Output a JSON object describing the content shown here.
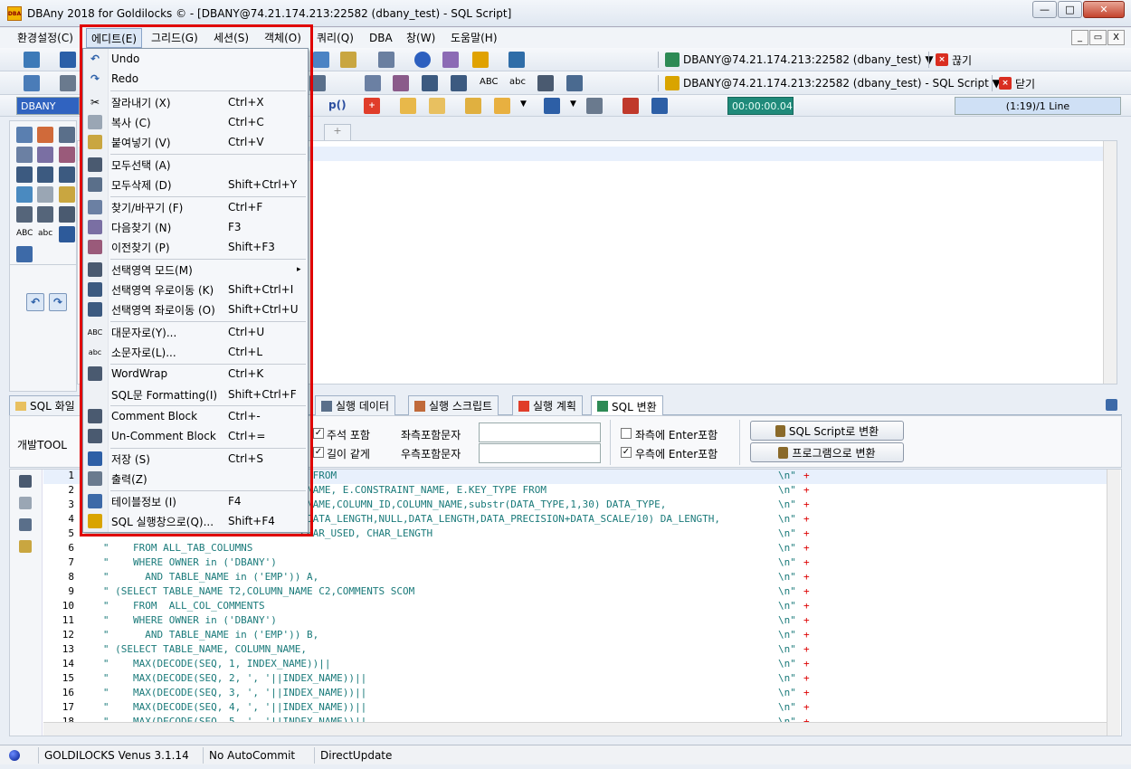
{
  "window": {
    "title": "DBAny 2018 for Goldilocks © - [DBANY@74.21.174.213:22582 (dbany_test) - SQL Script]",
    "app_icon_text": "DBA",
    "minimize": "—",
    "maximize": "□",
    "close": "✕"
  },
  "menubar": {
    "items": [
      {
        "label": "환경설정(C)"
      },
      {
        "label": "에디트(E)"
      },
      {
        "label": "그리드(G)"
      },
      {
        "label": "세션(S)"
      },
      {
        "label": "객체(O)"
      },
      {
        "label": "쿼리(Q)"
      },
      {
        "label": "DBA"
      },
      {
        "label": "창(W)"
      },
      {
        "label": "도움말(H)"
      }
    ],
    "mdi_min": "_",
    "mdi_restore": "▭",
    "mdi_close": "X"
  },
  "toolbar": {
    "connection1": "DBANY@74.21.174.213:22582 (dbany_test) ▼",
    "disconnect_label": "끊기",
    "connection2": "DBANY@74.21.174.213:22582 (dbany_test) - SQL Script ▼",
    "close_label": "닫기",
    "schema": "DBANY",
    "timer": "00:00:00.04",
    "position": "(1:19)/1 Line",
    "p_label": "p()",
    "abc_upper": "ABC",
    "abc_lower": "abc"
  },
  "edit_menu": {
    "items": [
      {
        "label": "Undo",
        "shortcut": ""
      },
      {
        "label": "Redo",
        "shortcut": ""
      },
      {
        "label": "잘라내기 (X)",
        "shortcut": "Ctrl+X"
      },
      {
        "label": "복사 (C)",
        "shortcut": "Ctrl+C"
      },
      {
        "label": "붙여넣기 (V)",
        "shortcut": "Ctrl+V"
      },
      {
        "label": "모두선택 (A)",
        "shortcut": ""
      },
      {
        "label": "모두삭제 (D)",
        "shortcut": "Shift+Ctrl+Y"
      },
      {
        "label": "찾기/바꾸기 (F)",
        "shortcut": "Ctrl+F"
      },
      {
        "label": "다음찾기 (N)",
        "shortcut": "F3"
      },
      {
        "label": "이전찾기 (P)",
        "shortcut": "Shift+F3"
      },
      {
        "label": "선택영역 모드(M)",
        "shortcut": "▸"
      },
      {
        "label": "선택영역 우로이동 (K)",
        "shortcut": "Shift+Ctrl+I"
      },
      {
        "label": "선택영역 좌로이동 (O)",
        "shortcut": "Shift+Ctrl+U"
      },
      {
        "label": "대문자로(Y)...",
        "shortcut": "Ctrl+U"
      },
      {
        "label": "소문자로(L)...",
        "shortcut": "Ctrl+L"
      },
      {
        "label": "WordWrap",
        "shortcut": "Ctrl+K"
      },
      {
        "label": "SQL문 Formatting(I)",
        "shortcut": "Shift+Ctrl+F"
      },
      {
        "label": "Comment Block",
        "shortcut": "Ctrl+-"
      },
      {
        "label": "Un-Comment Block",
        "shortcut": "Ctrl+="
      },
      {
        "label": "저장 (S)",
        "shortcut": "Ctrl+S"
      },
      {
        "label": "출력(Z)",
        "shortcut": ""
      },
      {
        "label": "테이블정보 (I)",
        "shortcut": "F4"
      },
      {
        "label": "SQL 실행창으로(Q)...",
        "shortcut": "Shift+F4"
      }
    ]
  },
  "bottom_tabs": [
    {
      "label": "SQL 화일"
    },
    {
      "label": "실행 데이터"
    },
    {
      "label": "실행 스크립트"
    },
    {
      "label": "실행 계획"
    },
    {
      "label": "SQL 변환"
    }
  ],
  "options": {
    "dev_tool_label": "개발TOOL",
    "include_comment": "주석 포함",
    "same_length": "길이 같게",
    "left_include_char": "좌측포함문자",
    "right_include_char": "우측포함문자",
    "left_enter_include": "좌측에 Enter포함",
    "right_enter_include": "우측에 Enter포함",
    "to_sql_script": "SQL Script로 변환",
    "to_program": "프로그램으로 변환",
    "check_mark": "✓"
  },
  "code": {
    "lines": [
      {
        "n": "1",
        "text": "                                    * FROM",
        "nl": "\\n\"",
        "plus": "+"
      },
      {
        "n": "2",
        "text": "                                   X_NAME, E.CONSTRAINT_NAME, E.KEY_TYPE FROM",
        "nl": "\\n\"",
        "plus": "+"
      },
      {
        "n": "3",
        "text": "                                   E_NAME,COLUMN_ID,COLUMN_NAME,substr(DATA_TYPE,1,30) DATA_TYPE,",
        "nl": "\\n\"",
        "plus": "+"
      },
      {
        "n": "4",
        "text": "                                   D,DATA_LENGTH,NULL,DATA_LENGTH,DATA_PRECISION+DATA_SCALE/10) DA_LENGTH,",
        "nl": "\\n\"",
        "plus": "+"
      },
      {
        "n": "5",
        "text": "                                    CHAR_USED, CHAR_LENGTH",
        "nl": "\\n\"",
        "plus": "+"
      },
      {
        "n": "6",
        "text": "   \"    FROM ALL_TAB_COLUMNS",
        "nl": "\\n\"",
        "plus": "+"
      },
      {
        "n": "7",
        "text": "   \"    WHERE OWNER in ('DBANY')",
        "nl": "\\n\"",
        "plus": "+"
      },
      {
        "n": "8",
        "text": "   \"      AND TABLE_NAME in ('EMP')) A,",
        "nl": "\\n\"",
        "plus": "+"
      },
      {
        "n": "9",
        "text": "   \" (SELECT TABLE_NAME T2,COLUMN_NAME C2,COMMENTS SCOM",
        "nl": "\\n\"",
        "plus": "+"
      },
      {
        "n": "10",
        "text": "   \"    FROM  ALL_COL_COMMENTS",
        "nl": "\\n\"",
        "plus": "+"
      },
      {
        "n": "11",
        "text": "   \"    WHERE OWNER in ('DBANY')",
        "nl": "\\n\"",
        "plus": "+"
      },
      {
        "n": "12",
        "text": "   \"      AND TABLE_NAME in ('EMP')) B,",
        "nl": "\\n\"",
        "plus": "+"
      },
      {
        "n": "13",
        "text": "   \" (SELECT TABLE_NAME, COLUMN_NAME,",
        "nl": "\\n\"",
        "plus": "+"
      },
      {
        "n": "14",
        "text": "   \"    MAX(DECODE(SEQ, 1, INDEX_NAME))||",
        "nl": "\\n\"",
        "plus": "+"
      },
      {
        "n": "15",
        "text": "   \"    MAX(DECODE(SEQ, 2, ', '||INDEX_NAME))||",
        "nl": "\\n\"",
        "plus": "+"
      },
      {
        "n": "16",
        "text": "   \"    MAX(DECODE(SEQ, 3, ', '||INDEX_NAME))||",
        "nl": "\\n\"",
        "plus": "+"
      },
      {
        "n": "17",
        "text": "   \"    MAX(DECODE(SEQ, 4, ', '||INDEX_NAME))||",
        "nl": "\\n\"",
        "plus": "+"
      },
      {
        "n": "18",
        "text": "   \"    MAX(DECODE(SEQ, 5, ', '||INDEX_NAME))||",
        "nl": "\\n\"",
        "plus": "+"
      }
    ]
  },
  "statusbar": {
    "server": "GOLDILOCKS Venus 3.1.14",
    "commit": "No AutoCommit",
    "update": "DirectUpdate"
  },
  "colors": {
    "highlight": "#e00000",
    "code_text": "#1a7a7a",
    "timer_bg": "#1f8a7a"
  }
}
